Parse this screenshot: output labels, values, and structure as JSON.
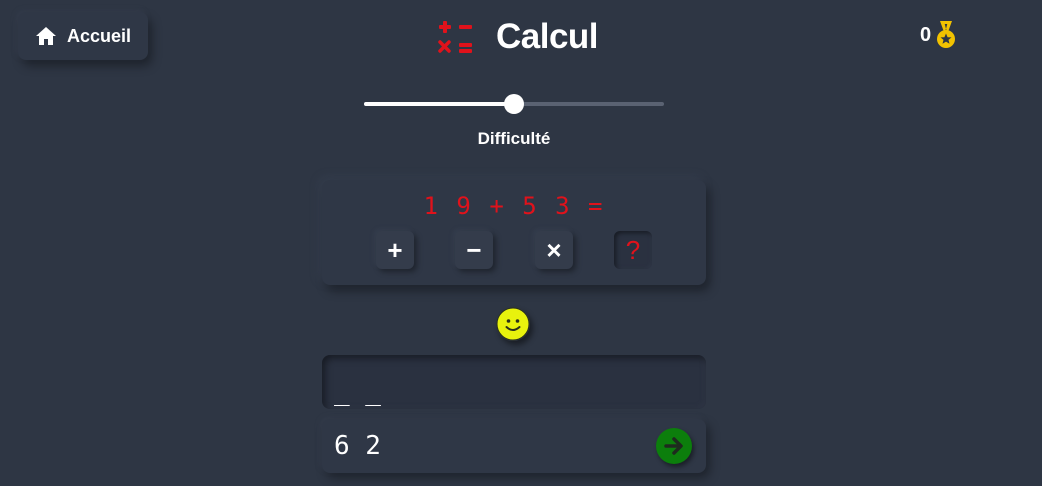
{
  "header": {
    "home_label": "Accueil",
    "title": "Calcul",
    "score": "0"
  },
  "difficulty": {
    "label": "Difficulté",
    "value_fraction": 0.5
  },
  "problem": {
    "text": "19+53=",
    "display": "1 9 + 5 3 ="
  },
  "operations": [
    {
      "symbol": "+",
      "name": "add",
      "active": false
    },
    {
      "symbol": "−",
      "name": "subtract",
      "active": false
    },
    {
      "symbol": "×",
      "name": "multiply",
      "active": false
    },
    {
      "symbol": "?",
      "name": "random",
      "active": true
    }
  ],
  "answer": {
    "slots_display": "_ _"
  },
  "input": {
    "value": "6 2"
  },
  "icons": {
    "home": "home-icon",
    "title": "calculator-operators-icon",
    "score": "medal-icon",
    "feedback": "smiley-icon",
    "submit": "arrow-right-icon"
  },
  "colors": {
    "background": "#2e3644",
    "accent_red": "#e0121b",
    "medal_gold": "#f2c200",
    "smiley_yellow": "#e8f20d",
    "submit_green": "#0c7e0c"
  }
}
